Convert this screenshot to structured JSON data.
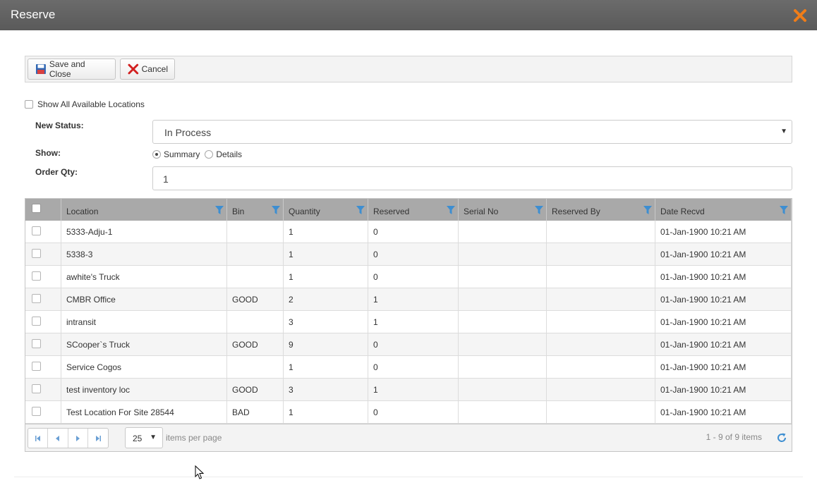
{
  "window": {
    "title": "Reserve"
  },
  "toolbar": {
    "save_label": "Save and Close",
    "cancel_label": "Cancel"
  },
  "form": {
    "show_all_label": "Show All Available Locations",
    "show_all_checked": false,
    "new_status_label": "New Status:",
    "new_status_value": "In Process",
    "show_label": "Show:",
    "show_options": [
      "Summary",
      "Details"
    ],
    "show_selected": "Summary",
    "order_qty_label": "Order Qty:",
    "order_qty_value": "1"
  },
  "grid": {
    "columns": [
      "Location",
      "Bin",
      "Quantity",
      "Reserved",
      "Serial No",
      "Reserved By",
      "Date Recvd"
    ],
    "rows": [
      [
        "5333-Adju-1",
        "",
        "1",
        "0",
        "",
        "",
        "01-Jan-1900 10:21 AM"
      ],
      [
        "5338-3",
        "",
        "1",
        "0",
        "",
        "",
        "01-Jan-1900 10:21 AM"
      ],
      [
        "awhite's Truck",
        "",
        "1",
        "0",
        "",
        "",
        "01-Jan-1900 10:21 AM"
      ],
      [
        "CMBR Office",
        "GOOD",
        "2",
        "1",
        "",
        "",
        "01-Jan-1900 10:21 AM"
      ],
      [
        "intransit",
        "",
        "3",
        "1",
        "",
        "",
        "01-Jan-1900 10:21 AM"
      ],
      [
        "SCooper`s Truck",
        "GOOD",
        "9",
        "0",
        "",
        "",
        "01-Jan-1900 10:21 AM"
      ],
      [
        "Service Cogos",
        "",
        "1",
        "0",
        "",
        "",
        "01-Jan-1900 10:21 AM"
      ],
      [
        "test inventory loc",
        "GOOD",
        "3",
        "1",
        "",
        "",
        "01-Jan-1900 10:21 AM"
      ],
      [
        "Test Location For Site 28544",
        "BAD",
        "1",
        "0",
        "",
        "",
        "01-Jan-1900 10:21 AM"
      ]
    ]
  },
  "pager": {
    "page_size": "25",
    "items_per_page_label": "items per page",
    "info": "1 - 9 of 9 items"
  },
  "colors": {
    "titlebar": "#5f5f5f",
    "header": "#a9a9a9",
    "filter_icon": "#3d8ed1",
    "close_icon": "#f07d18"
  }
}
